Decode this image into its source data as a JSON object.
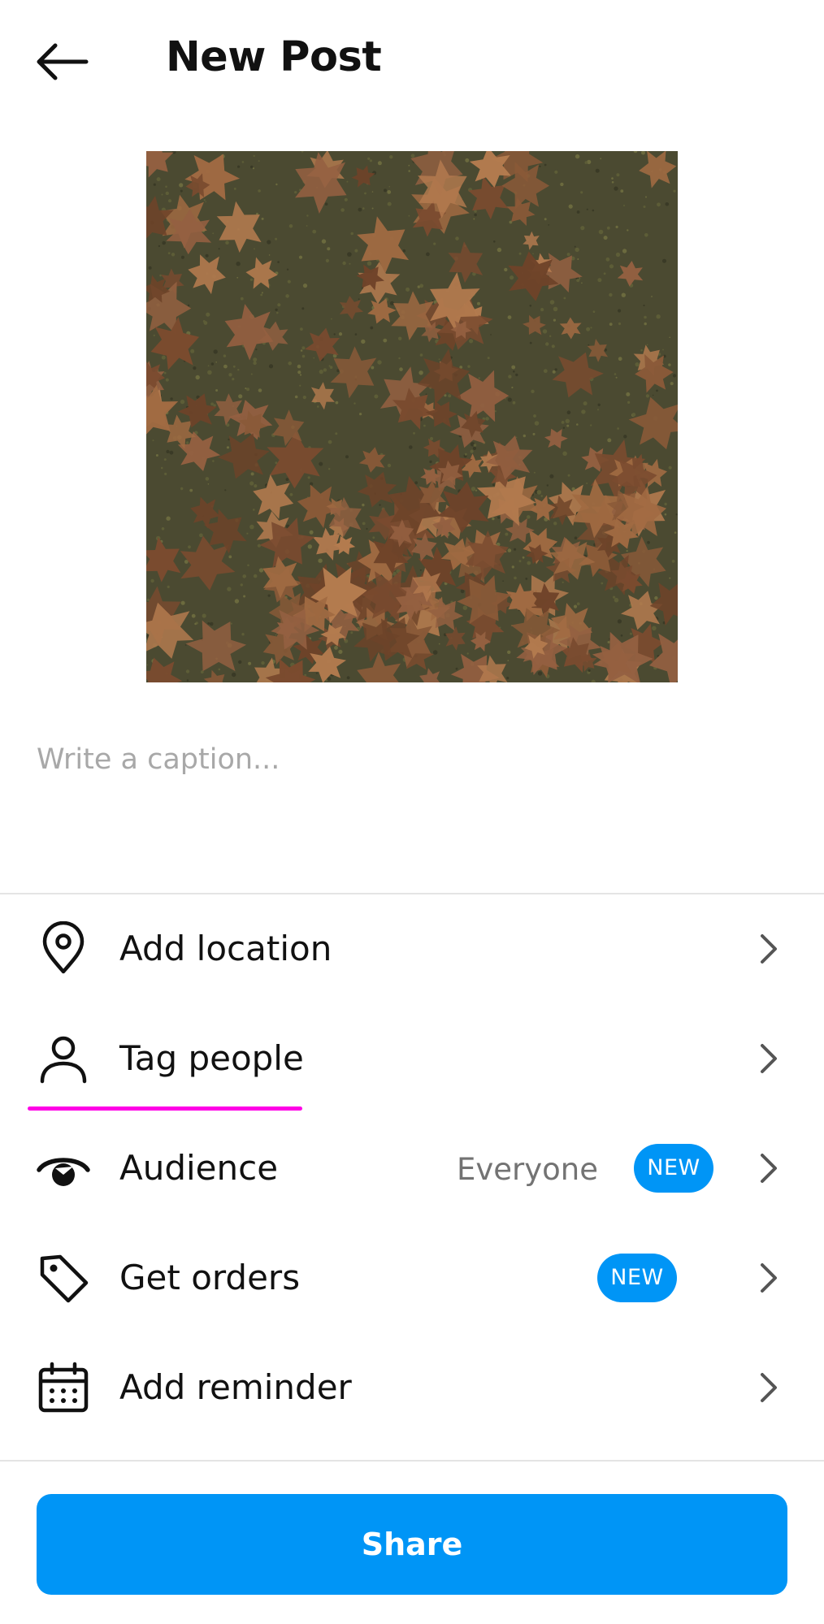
{
  "header": {
    "back_icon": "arrow-left-icon",
    "title": "New Post"
  },
  "caption": {
    "placeholder": "Write a caption...",
    "value": ""
  },
  "menu": {
    "items": [
      {
        "label": "Add location",
        "icon": "location-pin-icon"
      },
      {
        "label": "Tag people",
        "icon": "person-icon"
      },
      {
        "label": "Audience",
        "icon": "eye-icon",
        "value": "Everyone",
        "badge": "NEW"
      },
      {
        "label": "Get orders",
        "icon": "price-tag-icon",
        "badge": "NEW"
      },
      {
        "label": "Add reminder",
        "icon": "calendar-icon"
      }
    ]
  },
  "share": {
    "label": "Share"
  },
  "colors": {
    "accent": "#0095f6",
    "highlight": "#ff00e6",
    "secondary_text": "#737373",
    "placeholder": "#a8a8a8",
    "divider": "#e4e4e4"
  }
}
